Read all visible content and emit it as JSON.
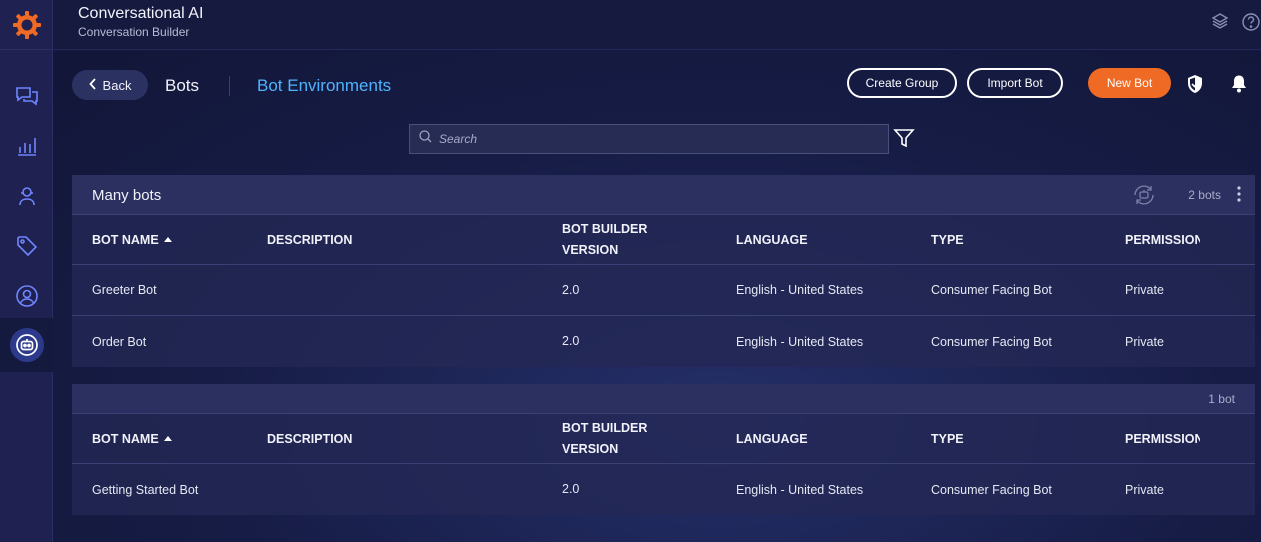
{
  "app": {
    "title": "Conversational AI",
    "subtitle": "Conversation Builder"
  },
  "rail": {
    "logo_icon": "gear-logo-icon",
    "accent": "#ef6a24",
    "items": [
      "chat-bubbles-icon",
      "analytics-icon",
      "agent-icon",
      "tag-icon",
      "user-circle-icon",
      "bot-icon"
    ],
    "active_item": "bot-icon"
  },
  "topbar": {
    "icons": [
      "layers-icon",
      "help-icon"
    ]
  },
  "header": {
    "back_label": "Back",
    "breadcrumb_bots": "Bots",
    "breadcrumb_environments": "Bot Environments",
    "create_group_label": "Create Group",
    "import_bot_label": "Import Bot",
    "new_bot_label": "New Bot",
    "new_bot_color": "#ef6a24",
    "link_color": "#4fb3ff"
  },
  "search": {
    "placeholder": "Search"
  },
  "columns": [
    "BOT NAME",
    "DESCRIPTION",
    "BOT BUILDER VERSION",
    "LANGUAGE",
    "TYPE",
    "PERMISSION"
  ],
  "groups": [
    {
      "title": "Many bots",
      "count": "2 bots",
      "rows": [
        {
          "name": "Greeter Bot",
          "description": "",
          "version": "2.0",
          "language": "English - United States",
          "type": "Consumer Facing Bot",
          "permission": "Private"
        },
        {
          "name": "Order Bot",
          "description": "",
          "version": "2.0",
          "language": "English - United States",
          "type": "Consumer Facing Bot",
          "permission": "Private"
        }
      ]
    },
    {
      "title": "",
      "count": "1 bot",
      "rows": [
        {
          "name": "Getting Started Bot",
          "description": "",
          "version": "2.0",
          "language": "English - United States",
          "type": "Consumer Facing Bot",
          "permission": "Private"
        }
      ]
    }
  ]
}
